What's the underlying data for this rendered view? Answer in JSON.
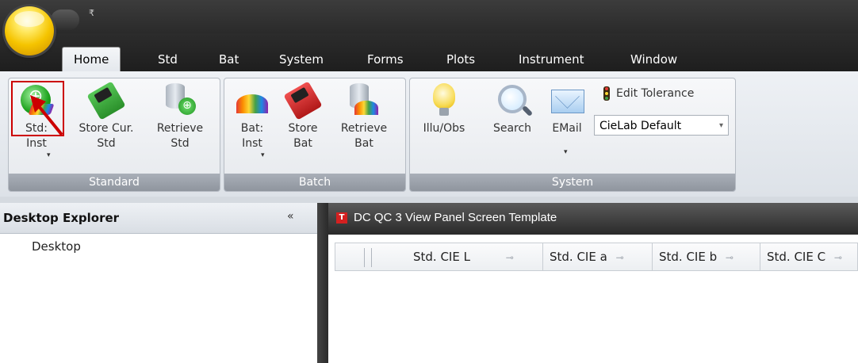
{
  "quick_access": {
    "icon": "customize-quick-access-icon",
    "glyph": "₹"
  },
  "tabs": [
    {
      "label": "Home",
      "active": true
    },
    {
      "label": "Std"
    },
    {
      "label": "Bat"
    },
    {
      "label": "System"
    },
    {
      "label": "Forms"
    },
    {
      "label": "Plots"
    },
    {
      "label": "Instrument"
    },
    {
      "label": "Window"
    }
  ],
  "ribbon": {
    "standard": {
      "label": "Standard",
      "buttons": [
        {
          "label": "Std:\nInst",
          "dropdown": "▾"
        },
        {
          "label": "Store Cur.\nStd"
        },
        {
          "label": "Retrieve\nStd"
        }
      ]
    },
    "batch": {
      "label": "Batch",
      "buttons": [
        {
          "label": "Bat:\nInst",
          "dropdown": "▾"
        },
        {
          "label": "Store\nBat"
        },
        {
          "label": "Retrieve\nBat"
        }
      ]
    },
    "system": {
      "label": "System",
      "buttons": [
        {
          "label": "Illu/Obs"
        },
        {
          "label": "Search"
        },
        {
          "label": "EMail",
          "dropdown": "▾"
        }
      ],
      "edit_tolerance": "Edit Tolerance",
      "tolerance_select": "CieLab Default"
    }
  },
  "explorer": {
    "title": "Desktop Explorer",
    "collapse_glyph": "«",
    "items": [
      "Desktop"
    ]
  },
  "document": {
    "title": "DC QC 3 View Panel Screen Template",
    "badge": "T",
    "columns": [
      "Std. CIE L",
      "Std. CIE a",
      "Std. CIE b",
      "Std. CIE C"
    ],
    "pin_glyph": "⊸"
  },
  "colors": {
    "highlight": "#cc0000",
    "title_bar": "#2a2a2a",
    "ribbon": "#e6e9ed"
  }
}
